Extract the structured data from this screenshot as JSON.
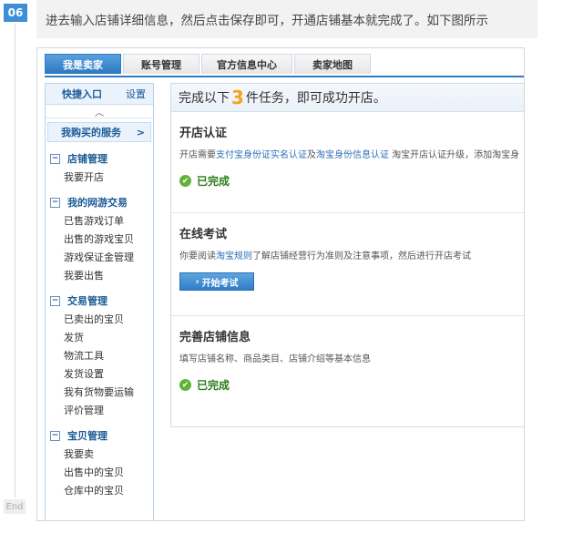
{
  "step": {
    "number": "06",
    "end_label": "End"
  },
  "instruction": "进去输入店铺详细信息，然后点击保存即可，开通店铺基本就完成了。如下图所示",
  "topnav": {
    "tabs": [
      {
        "label": "我是卖家",
        "active": true
      },
      {
        "label": "账号管理",
        "active": false
      },
      {
        "label": "官方信息中心",
        "active": false
      },
      {
        "label": "卖家地图",
        "active": false
      }
    ]
  },
  "sidebar": {
    "quick_entry": "快捷入口",
    "settings": "设置",
    "collapse_icon": "chevron-up-icon",
    "services_label": "我购买的服务",
    "services_arrow": ">",
    "groups": [
      {
        "title": "店铺管理",
        "items": [
          "我要开店"
        ]
      },
      {
        "title": "我的网游交易",
        "items": [
          "已售游戏订单",
          "出售的游戏宝贝",
          "游戏保证金管理",
          "我要出售"
        ]
      },
      {
        "title": "交易管理",
        "items": [
          "已卖出的宝贝",
          "发货",
          "物流工具",
          "发货设置",
          "我有货物要运输",
          "评价管理"
        ]
      },
      {
        "title": "宝贝管理",
        "items": [
          "我要卖",
          "出售中的宝贝",
          "仓库中的宝贝"
        ]
      }
    ],
    "toggle_symbol": "−"
  },
  "main": {
    "header_prefix": "完成以下",
    "header_count": "3",
    "header_suffix": "件任务，即可成功开店。",
    "sections": {
      "auth": {
        "title": "开店认证",
        "desc_1": "开店需要",
        "link_1": "支付宝身份证实名认证",
        "desc_2": "及",
        "link_2": "淘宝身份信息认证",
        "desc_3": " 淘宝开店认证升级，添加淘宝身",
        "status": "已完成"
      },
      "exam": {
        "title": "在线考试",
        "desc_1": "你要阅读",
        "link_1": "淘宝规则",
        "desc_2": "了解店铺经营行为准则及注意事项，然后进行开店考试",
        "button": "开始考试"
      },
      "info": {
        "title": "完善店铺信息",
        "desc": "填写店铺名称、商品类目、店铺介绍等基本信息",
        "status": "已完成"
      }
    }
  },
  "colors": {
    "accent": "#2f7dc4",
    "count": "#f7a21b",
    "done": "#5fb336"
  }
}
